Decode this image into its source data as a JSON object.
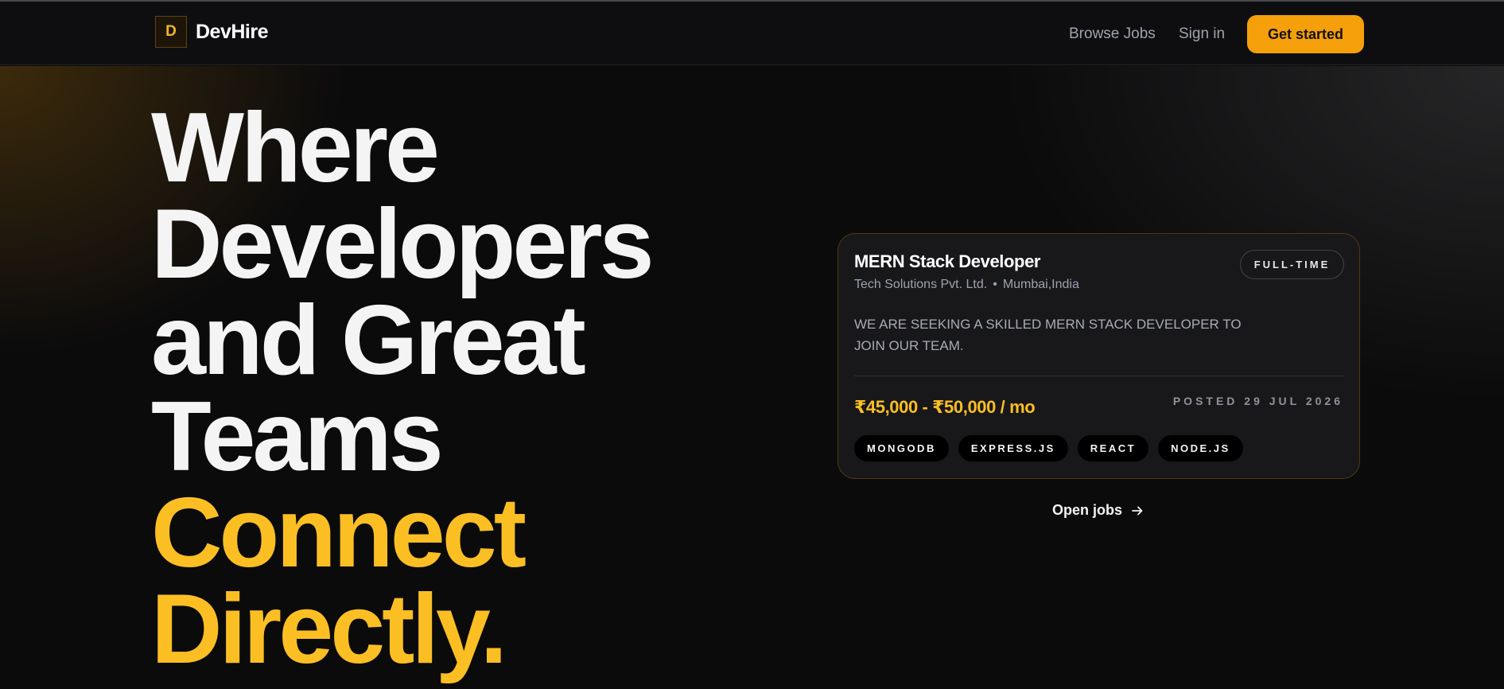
{
  "header": {
    "logo_letter": "D",
    "brand_name": "DevHire",
    "nav": {
      "browse_jobs": "Browse Jobs",
      "sign_in": "Sign in",
      "get_started": "Get started"
    }
  },
  "hero": {
    "headline_white": [
      "Where",
      "Developers",
      "and Great",
      "Teams"
    ],
    "headline_yellow": [
      "Connect",
      "Directly."
    ]
  },
  "job_card": {
    "title": "MERN Stack Developer",
    "company": "Tech Solutions Pvt. Ltd.",
    "separator": "•",
    "location": "Mumbai,India",
    "type": "FULL-TIME",
    "description": "WE ARE SEEKING A SKILLED MERN STACK DEVELOPER TO JOIN OUR TEAM.",
    "salary": "₹45,000 - ₹50,000 / mo",
    "posted": "POSTED 29 JUL 2026",
    "tags": [
      "MONGODB",
      "EXPRESS.JS",
      "REACT",
      "NODE.JS"
    ]
  },
  "open_jobs": {
    "label": "Open jobs",
    "icon": "arrow-right-icon"
  },
  "colors": {
    "accent": "#fbbf24",
    "cta": "#f59f0b",
    "background": "#0b0b0c",
    "card": "#18181a"
  }
}
